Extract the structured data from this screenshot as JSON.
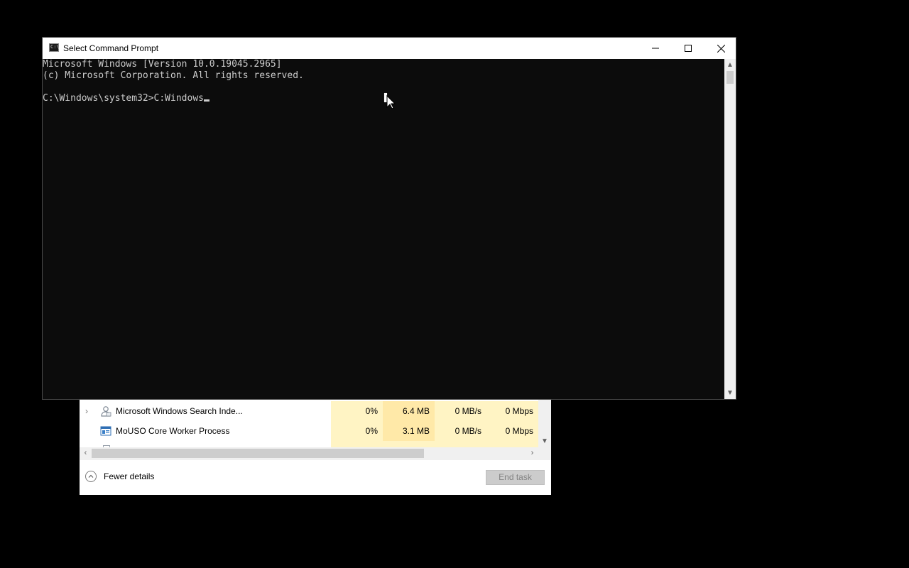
{
  "task_manager": {
    "processes": [
      {
        "name": "Microsoft Windows Search Inde...",
        "icon": "user-process-icon",
        "expandable": true,
        "cpu": "0%",
        "memory": "6.4 MB",
        "disk": "0 MB/s",
        "network": "0 Mbps"
      },
      {
        "name": "MoUSO Core Worker Process",
        "icon": "window-process-icon",
        "expandable": false,
        "cpu": "0%",
        "memory": "3.1 MB",
        "disk": "0 MB/s",
        "network": "0 Mbps"
      }
    ],
    "fewer_details_label": "Fewer details",
    "end_task_label": "End task"
  },
  "cmd": {
    "title": "Select Command Prompt",
    "icon_glyph": "C:\\",
    "lines": [
      "Microsoft Windows [Version 10.0.19045.2965]",
      "(c) Microsoft Corporation. All rights reserved.",
      "",
      "C:\\Windows\\system32>C:Windows"
    ],
    "colors": {
      "console_background": "#0c0c0c",
      "console_text": "#cccccc"
    }
  }
}
